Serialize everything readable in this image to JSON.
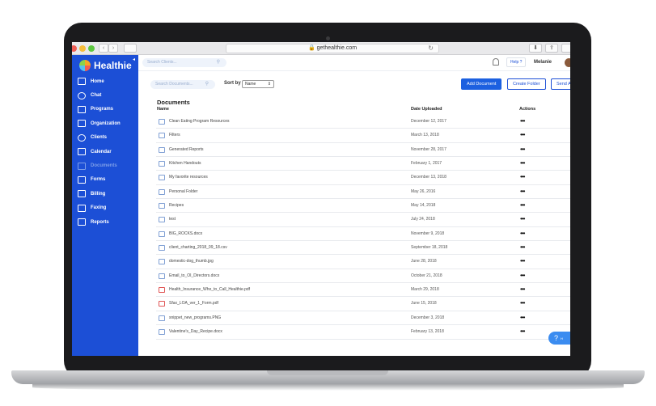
{
  "browser": {
    "url": "gethealthie.com",
    "reload_glyph": "↻",
    "back_glyph": "‹",
    "forward_glyph": "›"
  },
  "sidebar": {
    "brand": "Healthie",
    "collapse_glyph": "◂",
    "items": [
      {
        "label": "Home",
        "icon": "home-icon",
        "active": false
      },
      {
        "label": "Chat",
        "icon": "chat-icon",
        "active": false
      },
      {
        "label": "Programs",
        "icon": "programs-icon",
        "active": false
      },
      {
        "label": "Organization",
        "icon": "organization-icon",
        "active": false
      },
      {
        "label": "Clients",
        "icon": "clients-icon",
        "active": false
      },
      {
        "label": "Calendar",
        "icon": "calendar-icon",
        "active": false
      },
      {
        "label": "Documents",
        "icon": "documents-icon",
        "active": true
      },
      {
        "label": "Forms",
        "icon": "forms-icon",
        "active": false
      },
      {
        "label": "Billing",
        "icon": "billing-icon",
        "active": false
      },
      {
        "label": "Faxing",
        "icon": "faxing-icon",
        "active": false
      },
      {
        "label": "Reports",
        "icon": "reports-icon",
        "active": false
      }
    ]
  },
  "topbar": {
    "search_placeholder": "Search Clients...",
    "help_label": "Help ?",
    "user_name": "Melanie"
  },
  "toolbar": {
    "search_placeholder": "Search Documents...",
    "sort_label": "Sort by",
    "sort_value": "Name",
    "add_document": "Add Document",
    "create_folder": "Create Folder",
    "send_label": "Send A F"
  },
  "documents": {
    "title": "Documents",
    "columns": {
      "name": "Name",
      "date": "Date Uploaded",
      "actions": "Actions"
    },
    "actions_glyph": "•••",
    "rows": [
      {
        "name": "Clean Eating Program Resources",
        "date": "December 12, 2017",
        "kind": "folder"
      },
      {
        "name": "Filters",
        "date": "March 13, 2018",
        "kind": "folder"
      },
      {
        "name": "Generated Reports",
        "date": "November 28, 2017",
        "kind": "folder"
      },
      {
        "name": "Kitchen Handouts",
        "date": "February 1, 2017",
        "kind": "folder"
      },
      {
        "name": "My favorite resources",
        "date": "December 13, 2018",
        "kind": "folder"
      },
      {
        "name": "Personal Folder",
        "date": "May 26, 2016",
        "kind": "folder"
      },
      {
        "name": "Recipes",
        "date": "May 14, 2018",
        "kind": "folder"
      },
      {
        "name": "test",
        "date": "July 24, 2018",
        "kind": "folder"
      },
      {
        "name": "BIG_ROCKS.docx",
        "date": "November 9, 2018",
        "kind": "doc"
      },
      {
        "name": "client_charting_2018_09_18.csv",
        "date": "September 18, 2018",
        "kind": "doc"
      },
      {
        "name": "domestic-dog_thumb.jpg",
        "date": "June 28, 2018",
        "kind": "doc"
      },
      {
        "name": "Email_to_OI_Directors.docx",
        "date": "October 21, 2018",
        "kind": "doc"
      },
      {
        "name": "Health_Insurance_Who_to_Call_Healthie.pdf",
        "date": "March 29, 2018",
        "kind": "pdf"
      },
      {
        "name": "Sfax_LOA_ver_1_Form.pdf",
        "date": "June 15, 2018",
        "kind": "pdf"
      },
      {
        "name": "snippet_new_programs.PNG",
        "date": "December 3, 2018",
        "kind": "doc"
      },
      {
        "name": "Valentine's_Day_Recipe.docx",
        "date": "February 13, 2018",
        "kind": "doc"
      }
    ]
  },
  "help_fab": {
    "glyph": "?",
    "text": "H"
  },
  "colors": {
    "brand_blue": "#1c4fd6",
    "primary_button": "#1c60e0",
    "fab": "#3b8cf0"
  }
}
